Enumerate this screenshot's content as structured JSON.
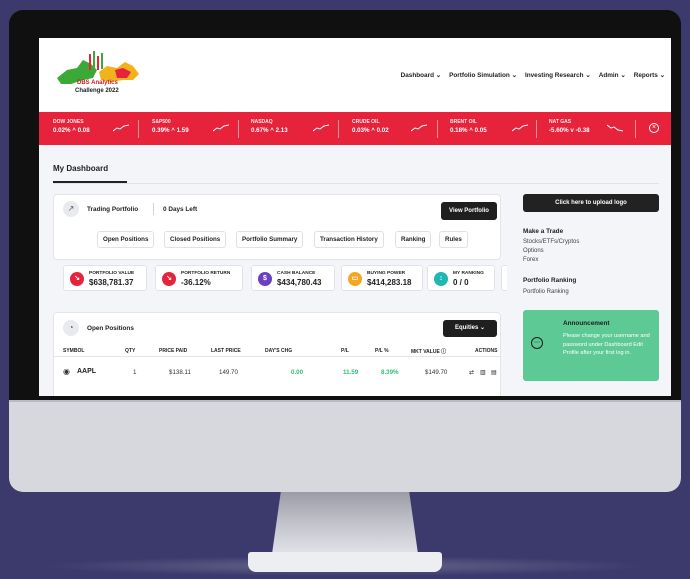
{
  "colors": {
    "background": "#3c3a6c",
    "ticker_red": "#e6233a",
    "positive_green": "#2fbf71",
    "announcement_green": "#5dc995"
  },
  "logo": {
    "line1": "DBS Analytics",
    "line2": "Challenge 2022"
  },
  "nav": {
    "items": [
      "Dashboard ⌄",
      "Portfolio Simulation ⌄",
      "Investing Research ⌄",
      "Admin ⌄",
      "Reports ⌄"
    ]
  },
  "ticker": {
    "items": [
      {
        "name": "DOW JONES",
        "value": "0.02% ^ 0.08",
        "trend": "up"
      },
      {
        "name": "S&P500",
        "value": "0.39% ^ 1.59",
        "trend": "up"
      },
      {
        "name": "NASDAQ",
        "value": "0.67% ^ 2.13",
        "trend": "up"
      },
      {
        "name": "CRUDE OIL",
        "value": "0.03% ^ 0.02",
        "trend": "up"
      },
      {
        "name": "BRENT OIL",
        "value": "0.18% ^ 0.05",
        "trend": "up"
      },
      {
        "name": "NAT GAS",
        "value": "-5.60% v -0.38",
        "trend": "down"
      }
    ],
    "close_icon": "close-circle-icon"
  },
  "dashboard": {
    "title": "My Dashboard"
  },
  "trading": {
    "title": "Trading Portfolio",
    "days_left": "0 Days Left",
    "view_button": "View Portfolio",
    "tabs": [
      "Open Positions",
      "Closed Positions",
      "Portfolio Summary",
      "Transaction History",
      "Ranking",
      "Rules"
    ]
  },
  "stats": [
    {
      "label": "PORTFOLIO VALUE",
      "value": "$638,781.37",
      "icon": "arrow-down-icon",
      "color": "#e6233a"
    },
    {
      "label": "PORTFOLIO RETURN",
      "value": "-36.12%",
      "icon": "arrow-down-icon",
      "color": "#e6233a"
    },
    {
      "label": "CASH BALANCE",
      "value": "$434,780.43",
      "icon": "cash-icon",
      "color": "#6a3fc1"
    },
    {
      "label": "BUYING POWER",
      "value": "$414,283.18",
      "icon": "wallet-icon",
      "color": "#f5a623"
    },
    {
      "label": "MY RANKING",
      "value": "0 / 0",
      "icon": "ranking-icon",
      "color": "#1fb7b3"
    }
  ],
  "positions": {
    "title": "Open Positions",
    "filter": "Equities ⌄",
    "headers": [
      "SYMBOL",
      "QTY",
      "PRICE PAID",
      "LAST PRICE",
      "DAY'S CHG",
      "P/L",
      "P/L %",
      "MKT VALUE ⓘ",
      "ACTIONS"
    ],
    "rows": [
      {
        "symbol": "AAPL",
        "qty": "1",
        "price_paid": "$138.11",
        "last_price": "149.70",
        "days_chg": "0.00",
        "pl": "11.59",
        "pl_pct": "8.39%",
        "mkt_value": "$149.70"
      }
    ]
  },
  "sidebar": {
    "upload_button": "Click here to upload logo",
    "trade_title": "Make a Trade",
    "trade_items": [
      "Stocks/ETFs/Cryptos",
      "Options",
      "Forex"
    ],
    "ranking_title": "Portfolio Ranking",
    "ranking_items": [
      "Portfolio Ranking"
    ]
  },
  "announcement": {
    "title": "Announcement",
    "text": "Please change your username and password under Dashboard Edit Profile after your first log in."
  }
}
